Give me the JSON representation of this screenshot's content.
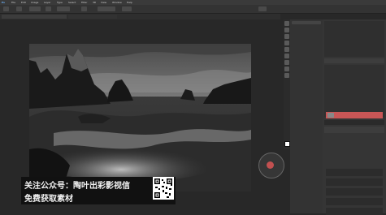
{
  "menubar": {
    "items": [
      "Ps",
      "File",
      "Edit",
      "Image",
      "Layer",
      "Type",
      "Select",
      "Filter",
      "3D",
      "View",
      "Window",
      "Help"
    ]
  },
  "overlay": {
    "line1": "关注公众号：陶叶出彩影视信",
    "line2": "免费获取素材"
  },
  "layers": {
    "active_layer_color": "#c95656"
  },
  "colors": {
    "background": "#282828",
    "panel": "#353535",
    "accent_red": "#c95656"
  },
  "icons": [
    "move-tool-icon",
    "marquee-tool-icon",
    "lasso-tool-icon",
    "crop-tool-icon",
    "brush-tool-icon",
    "eraser-tool-icon",
    "text-tool-icon",
    "hand-tool-icon",
    "zoom-tool-icon"
  ]
}
